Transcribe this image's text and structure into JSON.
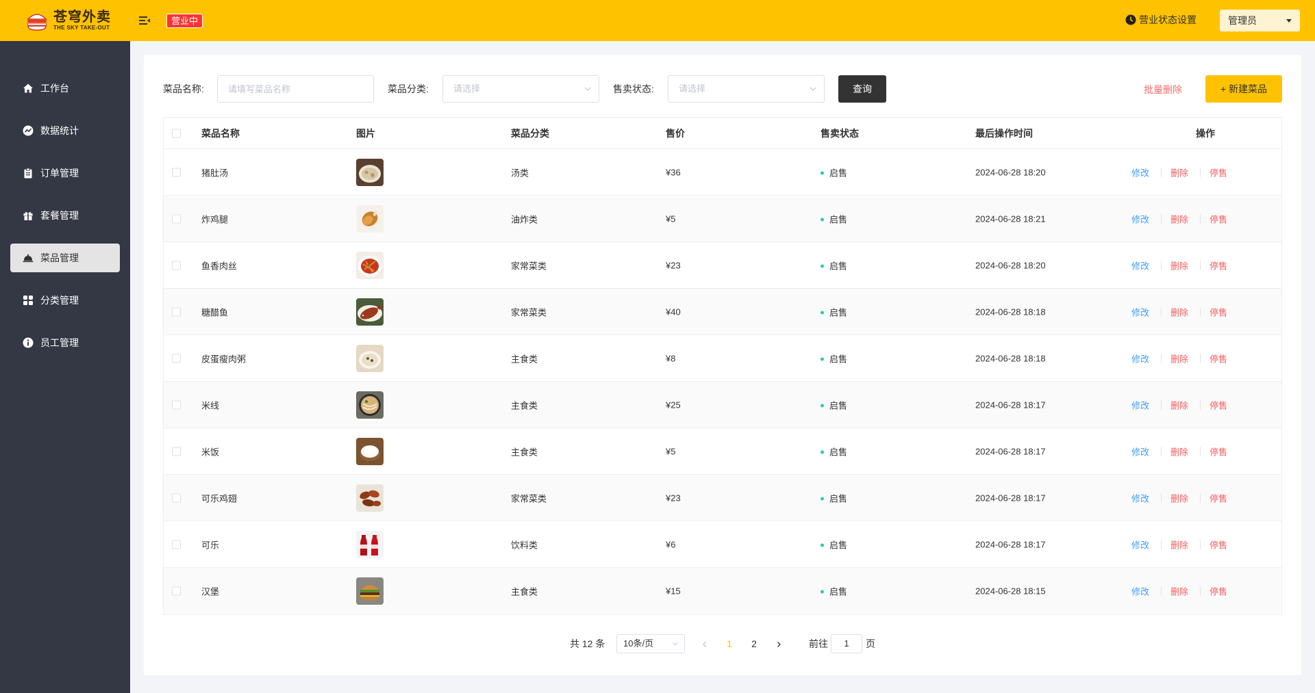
{
  "header": {
    "logo_cn": "苍穹外卖",
    "logo_en": "THE SKY TAKE-OUT",
    "status_badge": "营业中",
    "biz_setting_label": "营业状态设置",
    "user_label": "管理员",
    "colors": {
      "header_bg": "#ffc200",
      "badge_bg": "#fd3333"
    }
  },
  "sidebar": {
    "items": [
      {
        "label": "工作台",
        "icon": "home-icon"
      },
      {
        "label": "数据统计",
        "icon": "chart-icon"
      },
      {
        "label": "订单管理",
        "icon": "clipboard-icon"
      },
      {
        "label": "套餐管理",
        "icon": "gift-icon"
      },
      {
        "label": "菜品管理",
        "icon": "cloche-icon",
        "active": true
      },
      {
        "label": "分类管理",
        "icon": "grid-icon"
      },
      {
        "label": "员工管理",
        "icon": "info-icon"
      }
    ]
  },
  "filters": {
    "name_label": "菜品名称:",
    "name_placeholder": "请填写菜品名称",
    "category_label": "菜品分类:",
    "category_placeholder": "请选择",
    "status_label": "售卖状态:",
    "status_placeholder": "请选择",
    "query_button": "查询",
    "batch_delete_button": "批量删除",
    "new_button": "+ 新建菜品"
  },
  "table": {
    "headers": {
      "name": "菜品名称",
      "image": "图片",
      "category": "菜品分类",
      "price": "售价",
      "status": "售卖状态",
      "updated": "最后操作时间",
      "actions": "操作"
    },
    "action_labels": {
      "edit": "修改",
      "delete": "删除",
      "stop": "停售"
    },
    "rows": [
      {
        "name": "猪肚汤",
        "category": "汤类",
        "price": "¥36",
        "status": "启售",
        "updated": "2024-06-28 18:20",
        "image": "soup-bowl"
      },
      {
        "name": "炸鸡腿",
        "category": "油炸类",
        "price": "¥5",
        "status": "启售",
        "updated": "2024-06-28 18:21",
        "image": "fried-drumstick"
      },
      {
        "name": "鱼香肉丝",
        "category": "家常菜类",
        "price": "¥23",
        "status": "启售",
        "updated": "2024-06-28 18:20",
        "image": "shredded-pork"
      },
      {
        "name": "糖醋鱼",
        "category": "家常菜类",
        "price": "¥40",
        "status": "启售",
        "updated": "2024-06-28 18:18",
        "image": "sweet-sour-fish"
      },
      {
        "name": "皮蛋瘦肉粥",
        "category": "主食类",
        "price": "¥8",
        "status": "启售",
        "updated": "2024-06-28 18:18",
        "image": "congee"
      },
      {
        "name": "米线",
        "category": "主食类",
        "price": "¥25",
        "status": "启售",
        "updated": "2024-06-28 18:17",
        "image": "rice-noodle"
      },
      {
        "name": "米饭",
        "category": "主食类",
        "price": "¥5",
        "status": "启售",
        "updated": "2024-06-28 18:17",
        "image": "rice-bowl"
      },
      {
        "name": "可乐鸡翅",
        "category": "家常菜类",
        "price": "¥23",
        "status": "启售",
        "updated": "2024-06-28 18:17",
        "image": "cola-wings"
      },
      {
        "name": "可乐",
        "category": "饮料类",
        "price": "¥6",
        "status": "启售",
        "updated": "2024-06-28 18:17",
        "image": "cola-bottle"
      },
      {
        "name": "汉堡",
        "category": "主食类",
        "price": "¥15",
        "status": "启售",
        "updated": "2024-06-28 18:15",
        "image": "burger"
      }
    ]
  },
  "pagination": {
    "total_text": "共 12 条",
    "page_size": "10条/页",
    "pages": [
      "1",
      "2"
    ],
    "current_page": "1",
    "goto_prefix": "前往",
    "goto_value": "1",
    "goto_suffix": "页"
  }
}
